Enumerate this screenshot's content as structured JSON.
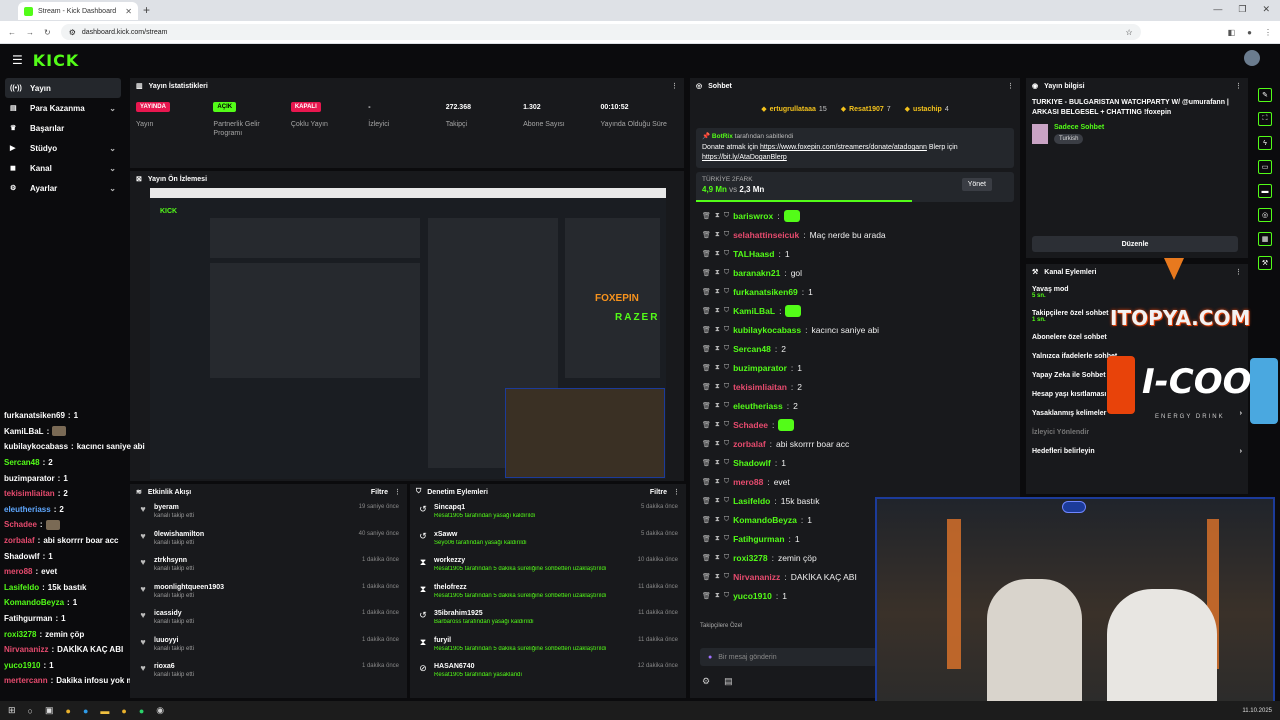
{
  "browser": {
    "tab_title": "Stream - Kick Dashboard",
    "url": "dashboard.kick.com/stream"
  },
  "brand": {
    "logo": "KICK",
    "accent": "#53fc18"
  },
  "sidebar": {
    "items": [
      {
        "label": "Yayın",
        "icon": "broadcast-icon",
        "chev": false
      },
      {
        "label": "Para Kazanma",
        "icon": "money-icon",
        "chev": true
      },
      {
        "label": "Başarılar",
        "icon": "trophy-icon",
        "chev": false
      },
      {
        "label": "Stüdyo",
        "icon": "studio-icon",
        "chev": true
      },
      {
        "label": "Kanal",
        "icon": "channel-icon",
        "chev": true
      },
      {
        "label": "Ayarlar",
        "icon": "settings-icon",
        "chev": true
      }
    ]
  },
  "stats": {
    "title": "Yayın İstatistikleri",
    "items": [
      {
        "value": "YAYINDA",
        "label": "Yayın",
        "badge": "red"
      },
      {
        "value": "AÇIK",
        "label": "Partnerlik Gelir Programı",
        "badge": "green"
      },
      {
        "value": "KAPALI",
        "label": "Çoklu Yayın",
        "badge": "red"
      },
      {
        "value": "-",
        "label": "İzleyici",
        "badge": ""
      },
      {
        "value": "272.368",
        "label": "Takipçi",
        "badge": ""
      },
      {
        "value": "1.302",
        "label": "Abone Sayısı",
        "badge": ""
      },
      {
        "value": "00:10:52",
        "label": "Yayında Olduğu Süre",
        "badge": ""
      }
    ]
  },
  "preview": {
    "title": "Yayın Ön İzlemesi"
  },
  "left_chat": [
    {
      "user": "furkanatsiken69",
      "msg": "1",
      "color": "#ffffff"
    },
    {
      "user": "KamiLBaL",
      "msg": "",
      "color": "#ffffff"
    },
    {
      "user": "kubilaykocabass",
      "msg": "kacıncı saniye abi",
      "color": "#ffffff"
    },
    {
      "user": "Sercan48",
      "msg": "2",
      "color": "#53fc18"
    },
    {
      "user": "buzimparator",
      "msg": "1",
      "color": "#ffffff"
    },
    {
      "user": "tekisimliaitan",
      "msg": "2",
      "color": "#e64b6e"
    },
    {
      "user": "eleutheriass",
      "msg": "2",
      "color": "#5fa8ff"
    },
    {
      "user": "Schadee",
      "msg": "",
      "color": "#e64b6e"
    },
    {
      "user": "zorbalaf",
      "msg": "abi skorrrr boar acc",
      "color": "#e64b6e"
    },
    {
      "user": "Shadowlf",
      "msg": "1",
      "color": "#ffffff"
    },
    {
      "user": "mero88",
      "msg": "evet",
      "color": "#e64b6e"
    },
    {
      "user": "Lasifeldo",
      "msg": "15k bastık",
      "color": "#53fc18"
    },
    {
      "user": "KomandoBeyza",
      "msg": "1",
      "color": "#53fc18"
    },
    {
      "user": "Fatihgurman",
      "msg": "1",
      "color": "#ffffff"
    },
    {
      "user": "roxi3278",
      "msg": "zemin çöp",
      "color": "#53fc18"
    },
    {
      "user": "Nirvananizz",
      "msg": "DAKİKA KAÇ ABI",
      "color": "#e64b6e"
    },
    {
      "user": "yuco1910",
      "msg": "1",
      "color": "#53fc18"
    },
    {
      "user": "mertercann",
      "msg": "Dakika infosu yok mu",
      "color": "#e64b6e"
    }
  ],
  "events": {
    "title": "Etkinlik Akışı",
    "filter": "Filtre",
    "items": [
      {
        "name": "byeram",
        "sub": "kanalı takip etti",
        "time": "19 saniye önce"
      },
      {
        "name": "0lewishamilton",
        "sub": "kanalı takip etti",
        "time": "40 saniye önce"
      },
      {
        "name": "ztrkhsynn",
        "sub": "kanalı takip etti",
        "time": "1 dakika önce"
      },
      {
        "name": "moonlightqueen1903",
        "sub": "kanalı takip etti",
        "time": "1 dakika önce"
      },
      {
        "name": "icassidy",
        "sub": "kanalı takip etti",
        "time": "1 dakika önce"
      },
      {
        "name": "luuoyyi",
        "sub": "kanalı takip etti",
        "time": "1 dakika önce"
      },
      {
        "name": "rioxa6",
        "sub": "kanalı takip etti",
        "time": "1 dakika önce"
      }
    ]
  },
  "mods": {
    "title": "Denetim Eylemleri",
    "filter": "Filtre",
    "items": [
      {
        "name": "Sincapq1",
        "sub": "Resat1905 tarafından yasağı kaldırıldı",
        "time": "5 dakika önce",
        "icon": "undo-icon"
      },
      {
        "name": "xSaww",
        "sub": "Seyo06 tarafından yasağı kaldırıldı",
        "time": "5 dakika önce",
        "icon": "undo-icon"
      },
      {
        "name": "workezzy",
        "sub": "Resat1905 tarafından 5 dakika süreliğine sohbetten uzaklaştırıldı",
        "time": "10 dakika önce",
        "icon": "hourglass-icon"
      },
      {
        "name": "thelofrezz",
        "sub": "Resat1905 tarafından 5 dakika süreliğine sohbetten uzaklaştırıldı",
        "time": "11 dakika önce",
        "icon": "hourglass-icon"
      },
      {
        "name": "35ibrahim1925",
        "sub": "Barbaross tarafından yasağı kaldırıldı",
        "time": "11 dakika önce",
        "icon": "undo-icon"
      },
      {
        "name": "furyil",
        "sub": "Resat1905 tarafından 5 dakika süreliğine sohbetten uzaklaştırıldı",
        "time": "11 dakika önce",
        "icon": "hourglass-icon"
      },
      {
        "name": "HASAN6740",
        "sub": "Resat1905 tarafından yasaklandı",
        "time": "12 dakika önce",
        "icon": "ban-icon"
      }
    ]
  },
  "chat": {
    "title": "Sohbet",
    "top_gifters": [
      {
        "name": "ertugrullataaa",
        "count": "15"
      },
      {
        "name": "Resat1907",
        "count": "7"
      },
      {
        "name": "ustachip",
        "count": "4"
      }
    ],
    "pinned": {
      "by": "BotRix",
      "by_suffix": "tarafından sabitlendi",
      "text": "Donate atmak için",
      "link1": "https://www.foxepin.com/streamers/donate/atadogann",
      "mid": "Blerp için",
      "link2": "https://bit.ly/AtaDoganBlerp"
    },
    "poll": {
      "label": "TÜRKİYE 2FARK",
      "left": "4,9 Mn",
      "vs": "vs",
      "right": "2,3 Mn",
      "button": "Yönet",
      "fill": 0.68
    },
    "messages": [
      {
        "user": "bariswrox",
        "msg": "",
        "color": "#53fc18"
      },
      {
        "user": "selahattinseicuk",
        "msg": "Maç nerde bu arada",
        "color": "#e64b6e"
      },
      {
        "user": "TALHaasd",
        "msg": "1",
        "color": "#53fc18"
      },
      {
        "user": "baranakn21",
        "msg": "gol",
        "color": "#53fc18"
      },
      {
        "user": "furkanatsiken69",
        "msg": "1",
        "color": "#53fc18"
      },
      {
        "user": "KamiLBaL",
        "msg": "",
        "color": "#53fc18"
      },
      {
        "user": "kubilaykocabass",
        "msg": "kacıncı saniye abi",
        "color": "#53fc18"
      },
      {
        "user": "Sercan48",
        "msg": "2",
        "color": "#53fc18"
      },
      {
        "user": "buzimparator",
        "msg": "1",
        "color": "#53fc18"
      },
      {
        "user": "tekisimliaitan",
        "msg": "2",
        "color": "#e64b6e"
      },
      {
        "user": "eleutheriass",
        "msg": "2",
        "color": "#53fc18"
      },
      {
        "user": "Schadee",
        "msg": "",
        "color": "#e64b6e"
      },
      {
        "user": "zorbalaf",
        "msg": "abi skorrrr boar acc",
        "color": "#e64b6e"
      },
      {
        "user": "Shadowlf",
        "msg": "1",
        "color": "#53fc18"
      },
      {
        "user": "mero88",
        "msg": "evet",
        "color": "#e64b6e"
      },
      {
        "user": "Lasifeldo",
        "msg": "15k bastık",
        "color": "#53fc18"
      },
      {
        "user": "KomandoBeyza",
        "msg": "1",
        "color": "#53fc18"
      },
      {
        "user": "Fatihgurman",
        "msg": "1",
        "color": "#53fc18"
      },
      {
        "user": "roxi3278",
        "msg": "zemin çöp",
        "color": "#53fc18"
      },
      {
        "user": "Nirvananizz",
        "msg": "DAKİKA KAÇ ABI",
        "color": "#e64b6e"
      },
      {
        "user": "yuco1910",
        "msg": "1",
        "color": "#53fc18"
      }
    ],
    "follower_only": "Takipçilere Özel",
    "input_placeholder": "Bir mesaj gönderin"
  },
  "info": {
    "title": "Yayın bilgisi",
    "stream_title": "TURKIYE - BULGARISTAN WATCHPARTY W/ @umurafann | ARKASI BELGESEL + CHATTING !foxepin",
    "category": "Sadece Sohbet",
    "tag": "Turkish",
    "edit": "Düzenle"
  },
  "actions": {
    "title": "Kanal Eylemleri",
    "items": [
      {
        "label": "Yavaş mod",
        "sub": "5 sn.",
        "chev": true
      },
      {
        "label": "Takipçilere özel sohbet",
        "sub": "1 sn.",
        "chev": false
      },
      {
        "label": "Abonelere özel sohbet",
        "sub": "",
        "chev": false
      },
      {
        "label": "Yalnızca ifadelerle sohbet",
        "sub": "",
        "chev": false
      },
      {
        "label": "Yapay Zeka ile Sohbet",
        "sub": "",
        "chev": false
      },
      {
        "label": "Hesap yaşı kısıtlaması",
        "sub": "",
        "chev": false
      },
      {
        "label": "Yasaklanmış kelimeler",
        "sub": "",
        "chev": true
      },
      {
        "label": "İzleyici Yönlendir",
        "sub": "",
        "chev": false
      },
      {
        "label": "Hedefleri belirleyin",
        "sub": "",
        "chev": true
      }
    ]
  },
  "overlays": {
    "itopya": "ITOPYA.COM",
    "icool": "I-COOL",
    "icool_sub": "ENERGY DRINK",
    "foxepin": "FOXEPIN",
    "razer": "RAZER"
  },
  "taskbar": {
    "date": "11.10.2025"
  }
}
